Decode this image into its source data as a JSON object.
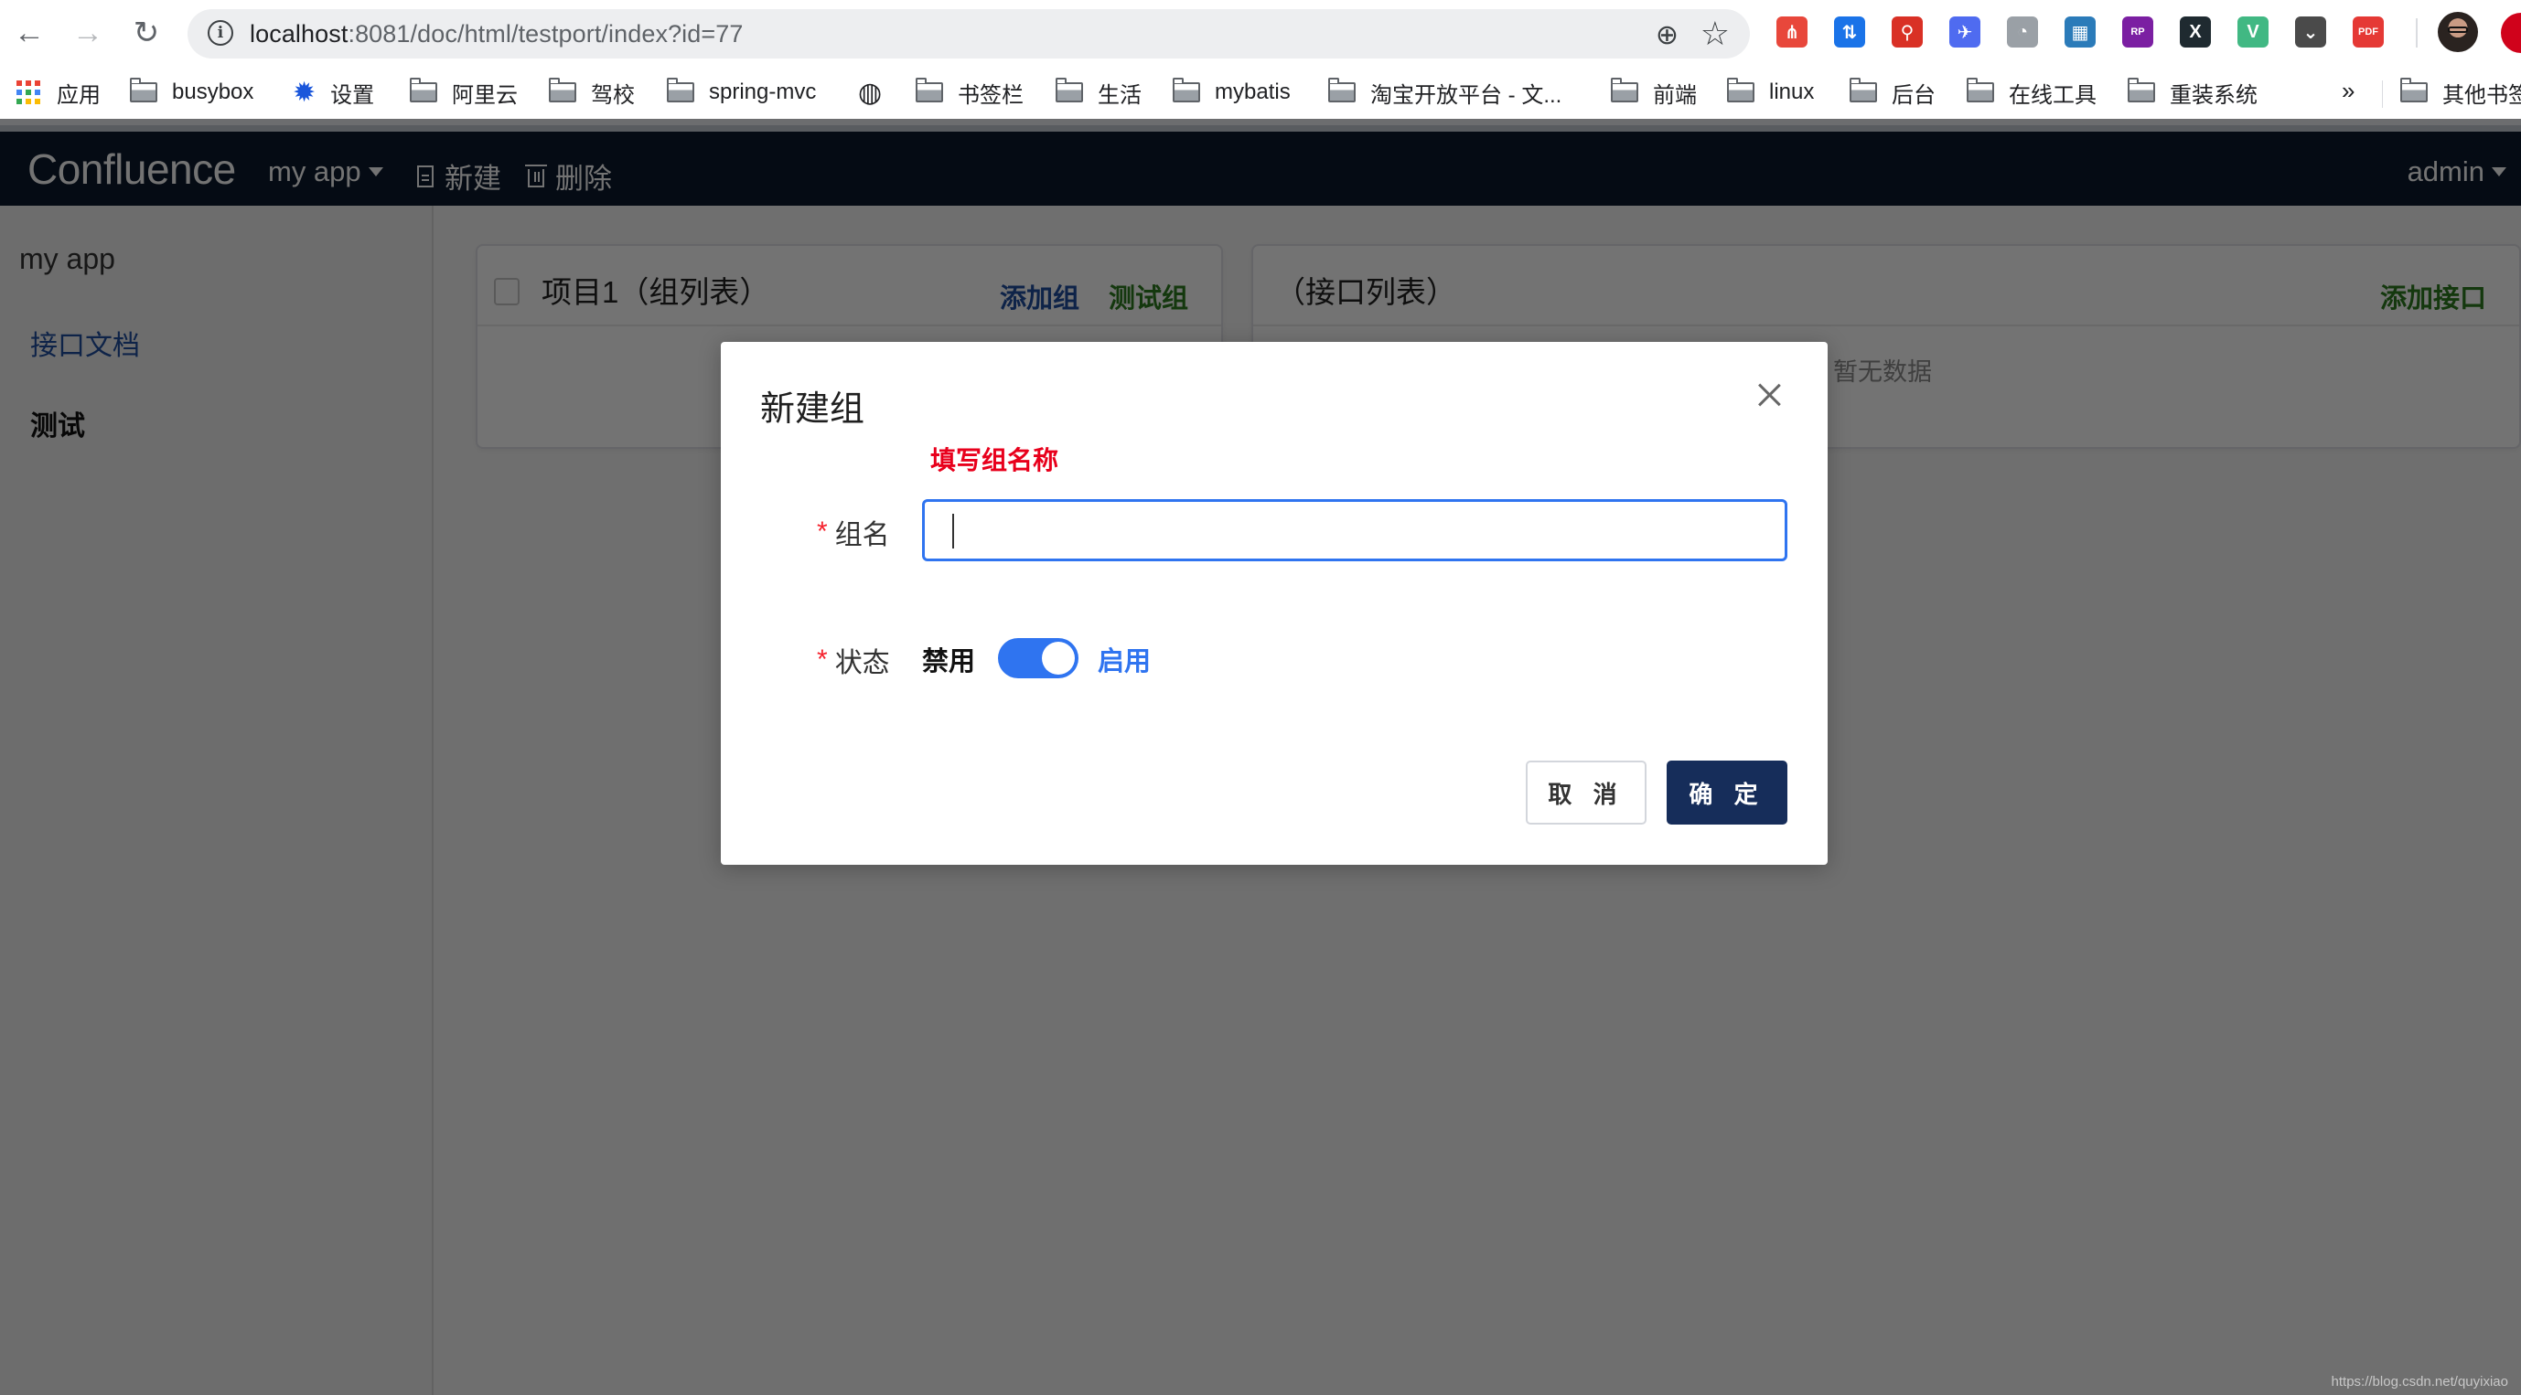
{
  "browser": {
    "url_host": "localhost",
    "url_path": ":8081/doc/html/testport/index?id=77",
    "nav": {
      "back": "←",
      "forward": "→",
      "reload": "↻"
    },
    "omnibox_icons": {
      "info": "i",
      "zoom": "⊕",
      "bookmark_star": "☆"
    },
    "extensions": [
      {
        "name": "sitemap-extension",
        "glyph": "⋔",
        "bg": "#e8473b"
      },
      {
        "name": "transfer-ex-extension",
        "glyph": "⇅",
        "bg": "#1a73e8"
      },
      {
        "name": "location-pin-extension",
        "glyph": "⚲",
        "bg": "#d93025"
      },
      {
        "name": "bird-extension",
        "glyph": "✈",
        "bg": "#4f6bf0"
      },
      {
        "name": "speedometer-extension",
        "glyph": "◔",
        "bg": "#9aa0a6"
      },
      {
        "name": "screenshot-extension",
        "glyph": "▦",
        "bg": "#2b7bb9"
      },
      {
        "name": "axure-rp-extension",
        "glyph": "RP",
        "bg": "#7b1fa2"
      },
      {
        "name": "x-extension",
        "glyph": "X",
        "bg": "#1f2a30"
      },
      {
        "name": "vue-devtools-extension",
        "glyph": "V",
        "bg": "#41b883"
      },
      {
        "name": "pocket-extension",
        "glyph": "⌄",
        "bg": "#4a4a4a"
      },
      {
        "name": "pdfjs-extension",
        "glyph": "PDF",
        "bg": "#e53935"
      }
    ],
    "bookmarks": {
      "apps_label": "应用",
      "items": [
        "busybox",
        "设置",
        "阿里云",
        "驾校",
        "spring-mvc",
        "",
        "书签栏",
        "生活",
        "mybatis",
        "淘宝开放平台 - 文...",
        "前端",
        "linux",
        "后台",
        "在线工具",
        "重装系统"
      ],
      "more": "»",
      "other": "其他书签"
    }
  },
  "app": {
    "brand": "Confluence",
    "app_switcher": "my app",
    "actions": {
      "new": "新建",
      "delete": "删除"
    },
    "user": "admin",
    "sidebar": {
      "title": "my app",
      "items": [
        {
          "label": "接口文档",
          "active": false
        },
        {
          "label": "测试",
          "active": true
        }
      ]
    },
    "group_panel": {
      "title": "项目1（组列表）",
      "add_group": "添加组",
      "test_group": "测试组",
      "link_colors": {
        "add": "#1f4ea1",
        "test": "#2e7d1f"
      }
    },
    "api_panel": {
      "title": "（接口列表）",
      "add_api": "添加接口",
      "empty": "暂无数据"
    }
  },
  "modal": {
    "title": "新建组",
    "hint": "填写组名称",
    "fields": {
      "name": {
        "label": "组名",
        "required": true,
        "value": "",
        "placeholder": ""
      },
      "status": {
        "label": "状态",
        "required": true,
        "off_label": "禁用",
        "on_label": "启用",
        "enabled": true
      }
    },
    "buttons": {
      "cancel": "取 消",
      "ok": "确 定"
    },
    "colors": {
      "primary": "#2f74f0",
      "ok_button": "#162d5a",
      "hint": "#e8001c"
    }
  },
  "watermark": "https://blog.csdn.net/quyixiao"
}
